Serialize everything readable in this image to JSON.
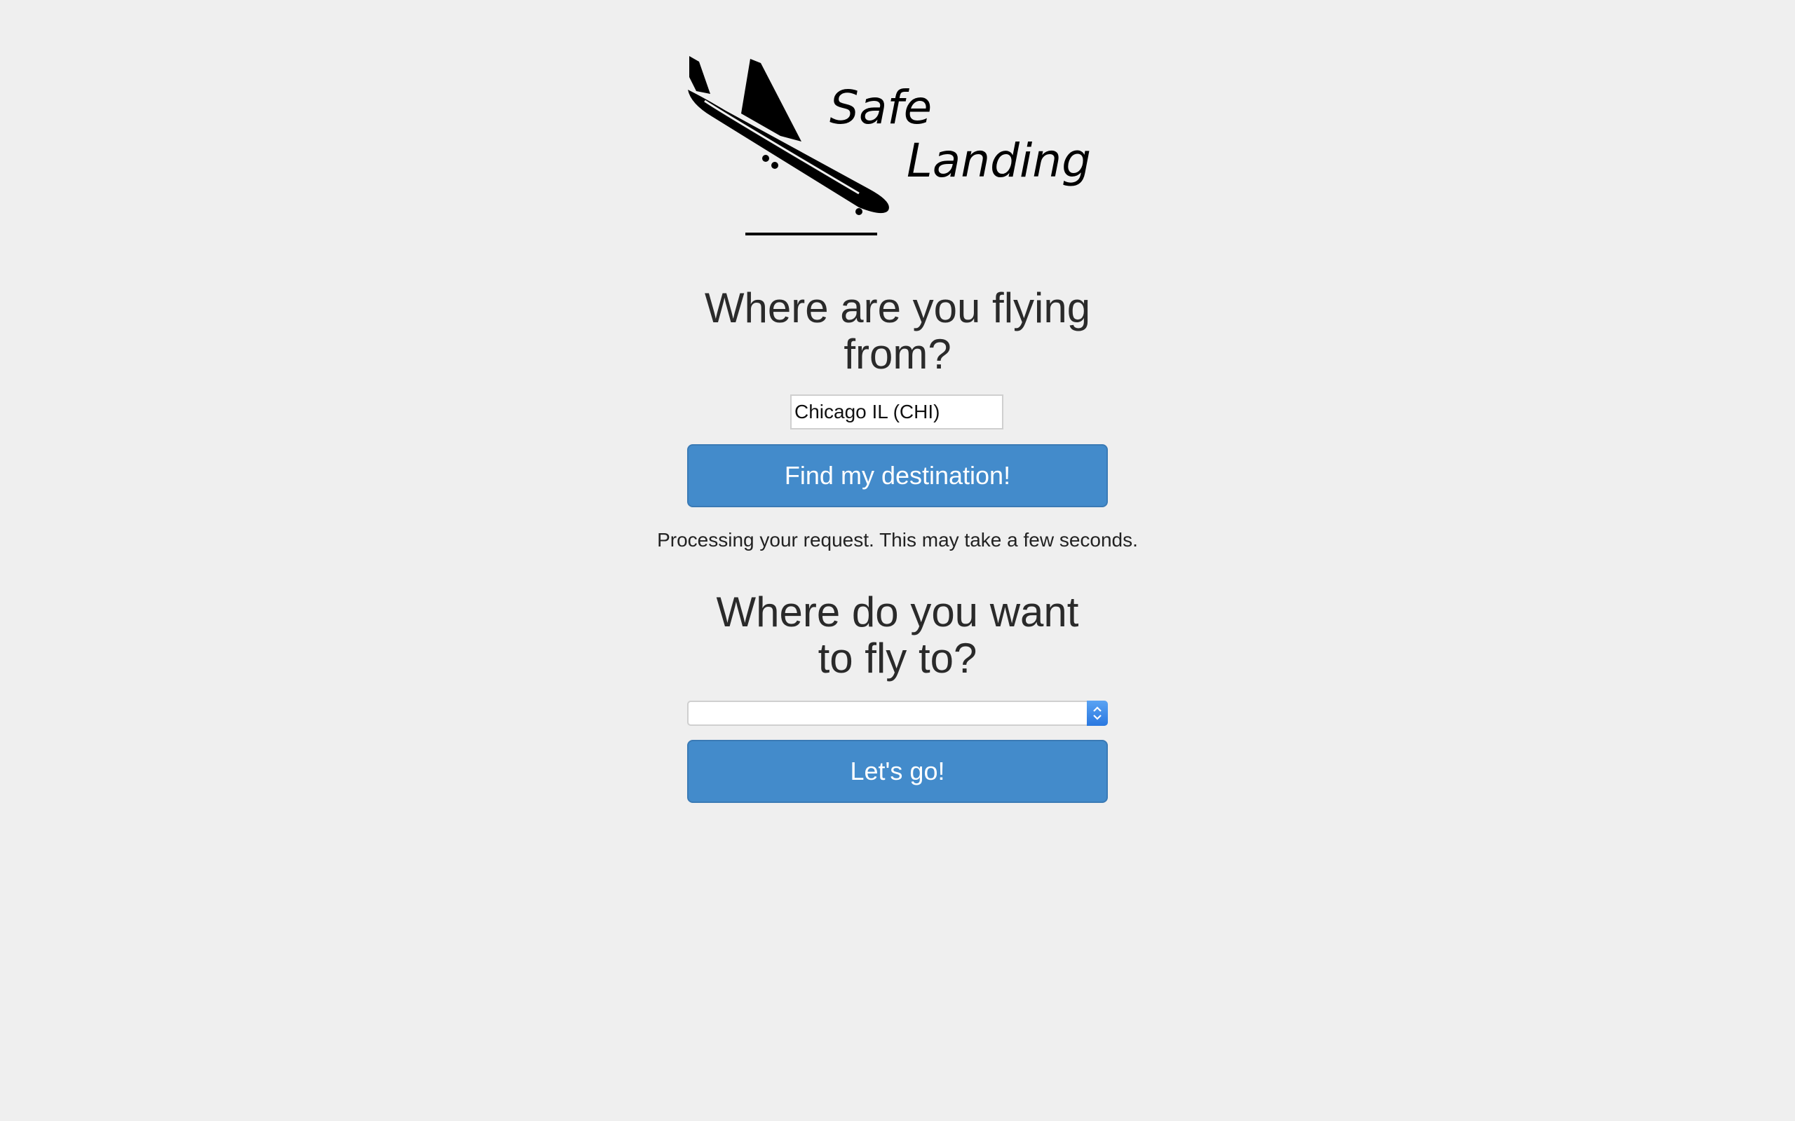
{
  "logo": {
    "line1": "Safe",
    "line2": "Landing",
    "icon": "airplane-landing-icon"
  },
  "origin": {
    "heading_line1": "Where are you flying",
    "heading_line2": "from?",
    "input_value": "Chicago IL (CHI)",
    "button_label": "Find my destination!"
  },
  "status": {
    "message": "Processing your request. This may take a few seconds."
  },
  "destination": {
    "heading_line1": "Where do you want",
    "heading_line2": "to fly to?",
    "selected_value": "",
    "button_label": "Let's go!"
  },
  "colors": {
    "background": "#efefef",
    "button": "#438bcb",
    "select_arrow": "#2a78e0"
  }
}
